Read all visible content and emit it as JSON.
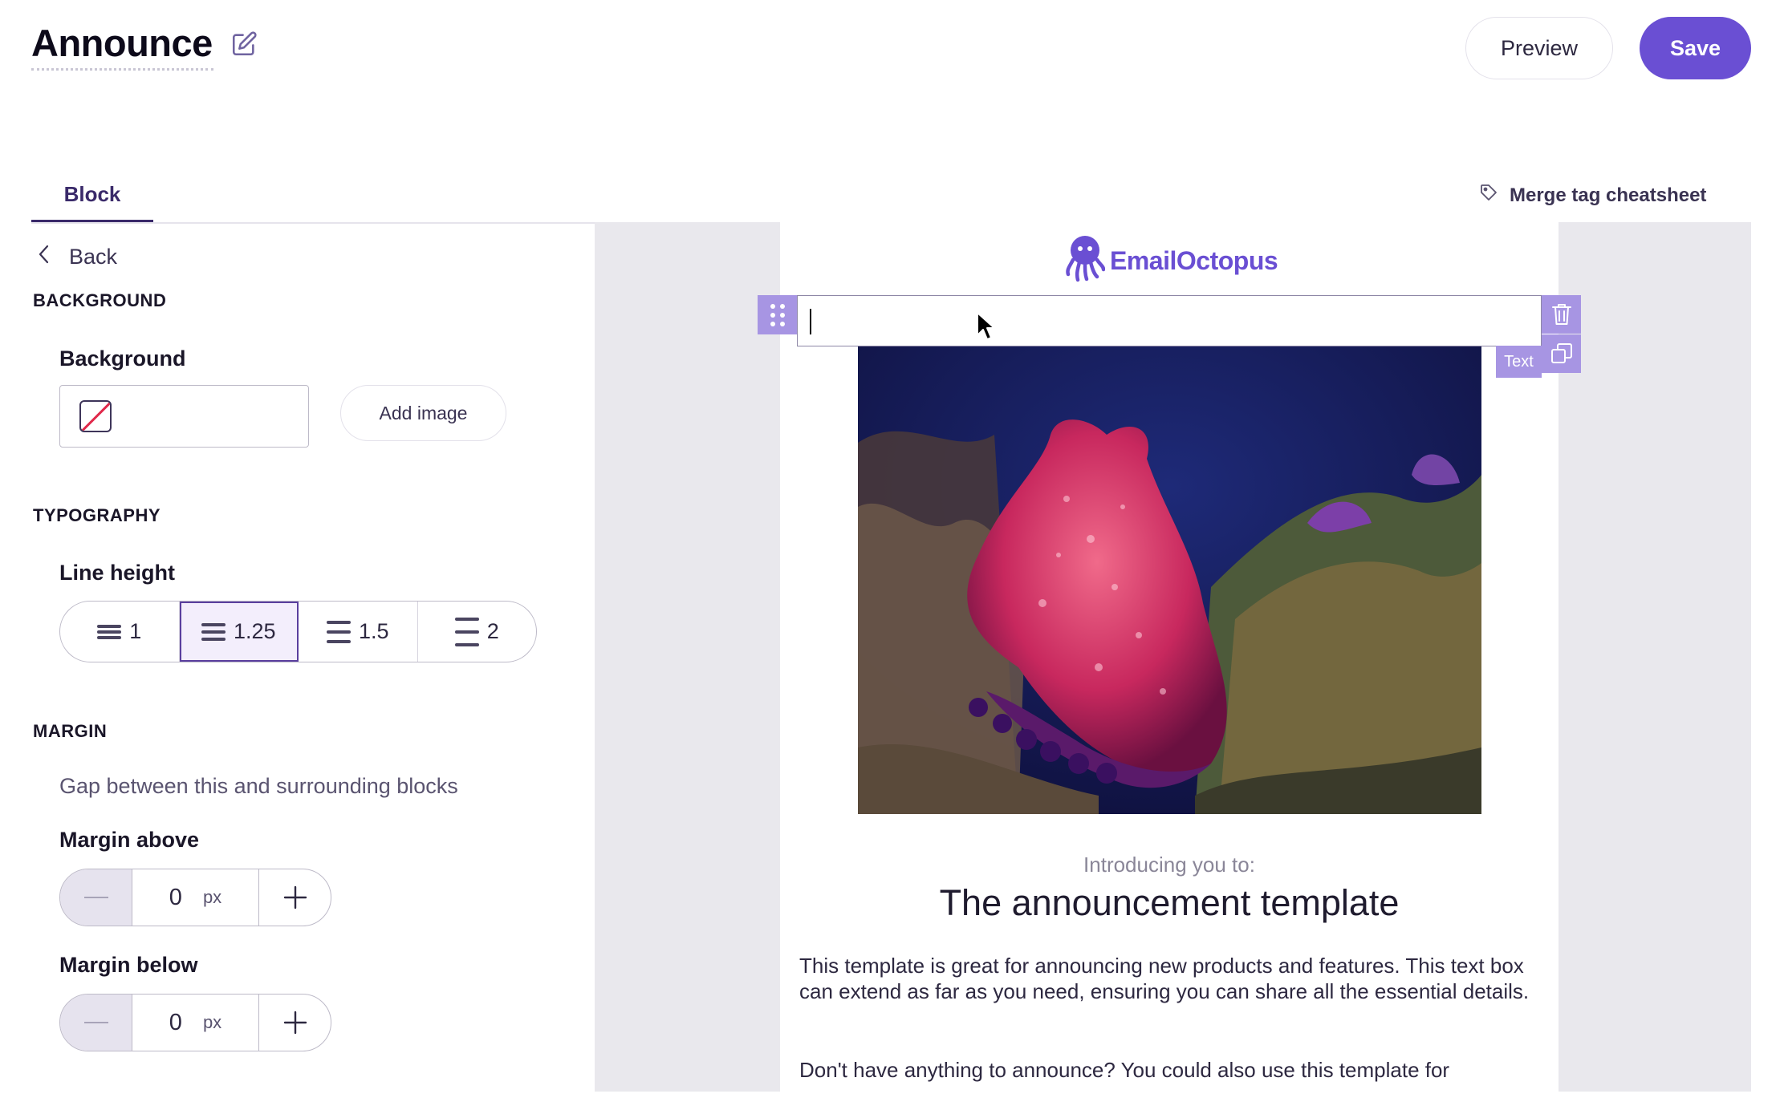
{
  "header": {
    "title": "Announce",
    "preview_label": "Preview",
    "save_label": "Save"
  },
  "tabs": [
    {
      "label": "Block",
      "active": true
    }
  ],
  "merge_tag_label": "Merge tag cheatsheet",
  "sidebar": {
    "back_label": "Back",
    "background_section": "BACKGROUND",
    "background_label": "Background",
    "add_image_label": "Add image",
    "typography_section": "TYPOGRAPHY",
    "line_height_label": "Line height",
    "line_height_options": [
      "1",
      "1.25",
      "1.5",
      "2"
    ],
    "line_height_selected": "1.25",
    "margin_section": "MARGIN",
    "margin_help": "Gap between this and surrounding blocks",
    "margin_above_label": "Margin above",
    "margin_above_value": "0",
    "margin_below_label": "Margin below",
    "margin_below_value": "0",
    "unit": "px"
  },
  "email": {
    "logo_text": "EmailOctopus",
    "text_block_tag": "Text",
    "intro": "Introducing you to:",
    "headline": "The announcement template",
    "paragraph_1": "This template is great for announcing new products and features. This text box can extend as far as you need, ensuring you can share all the essential details.",
    "paragraph_2": "Don't have anything to announce? You could also use this template for"
  },
  "colors": {
    "accent": "#6a4fd3",
    "toolbar": "#a795e3",
    "canvas_bg": "#e9e8ed"
  },
  "icons": [
    "edit-icon",
    "tag-icon",
    "chevron-left-icon",
    "no-color-icon",
    "drag-handle-icon",
    "trash-icon",
    "duplicate-icon",
    "cursor-icon",
    "octopus-logo-icon"
  ]
}
